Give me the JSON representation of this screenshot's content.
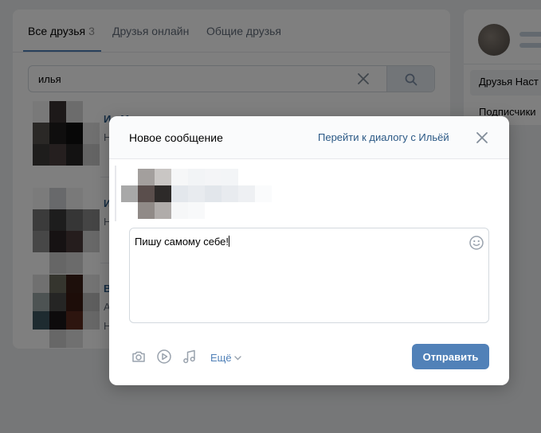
{
  "friends_page": {
    "tabs": [
      {
        "label": "Все друзья",
        "count": "3"
      },
      {
        "label": "Друзья онлайн"
      },
      {
        "label": "Общие друзья"
      }
    ],
    "search": {
      "value": "илья"
    },
    "friends": [
      {
        "name": "Ил М",
        "sub": "Н"
      },
      {
        "name": "И",
        "sub": "Н"
      },
      {
        "name": "В",
        "sub": "А",
        "sub2": "Н"
      }
    ]
  },
  "sidebar": {
    "items": [
      {
        "label": "Друзья Наст"
      },
      {
        "label": "Подписчики"
      }
    ]
  },
  "modal": {
    "title": "Новое сообщение",
    "dialog_link": "Перейти к диалогу с Ильёй",
    "message": "Пишу самому себе!",
    "more_label": "Ещё",
    "send_label": "Отправить"
  },
  "colors": {
    "accent": "#5181b8",
    "link": "#2a5885",
    "overlay": "rgba(0,0,0,0.5)"
  },
  "icons": [
    "close-icon",
    "search-icon",
    "clear-icon",
    "emoji-icon",
    "camera-icon",
    "video-icon",
    "music-icon",
    "chevron-down-icon"
  ]
}
